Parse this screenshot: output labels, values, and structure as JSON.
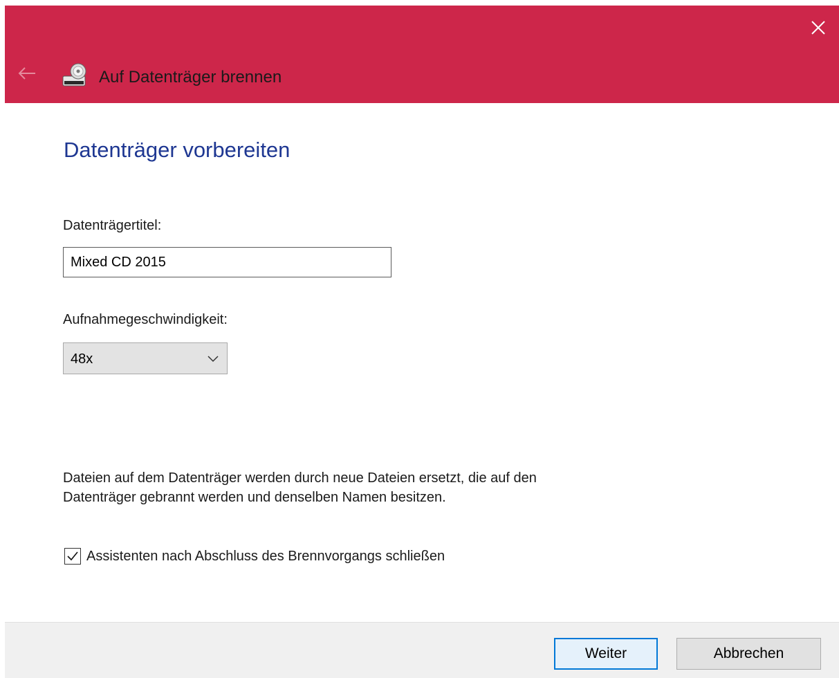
{
  "window": {
    "title": "Auf Datenträger brennen",
    "accent_color": "#cd264a"
  },
  "page": {
    "heading": "Datenträger vorbereiten",
    "disc_title_label": "Datenträgertitel:",
    "disc_title_value": "Mixed CD 2015",
    "speed_label": "Aufnahmegeschwindigkeit:",
    "speed_value": "48x",
    "info_line1": "Dateien auf dem Datenträger werden durch neue Dateien ersetzt, die auf den",
    "info_line2": "Datenträger gebrannt werden und denselben Namen besitzen.",
    "close_checkbox_label": "Assistenten nach Abschluss des Brennvorgangs schließen",
    "close_checkbox_checked": true
  },
  "footer": {
    "next_label": "Weiter",
    "cancel_label": "Abbrechen"
  },
  "icons": {
    "close": "close-icon",
    "back": "back-arrow-icon",
    "wizard": "burn-disc-icon",
    "dropdown": "chevron-down-icon",
    "check": "checkmark-icon"
  }
}
